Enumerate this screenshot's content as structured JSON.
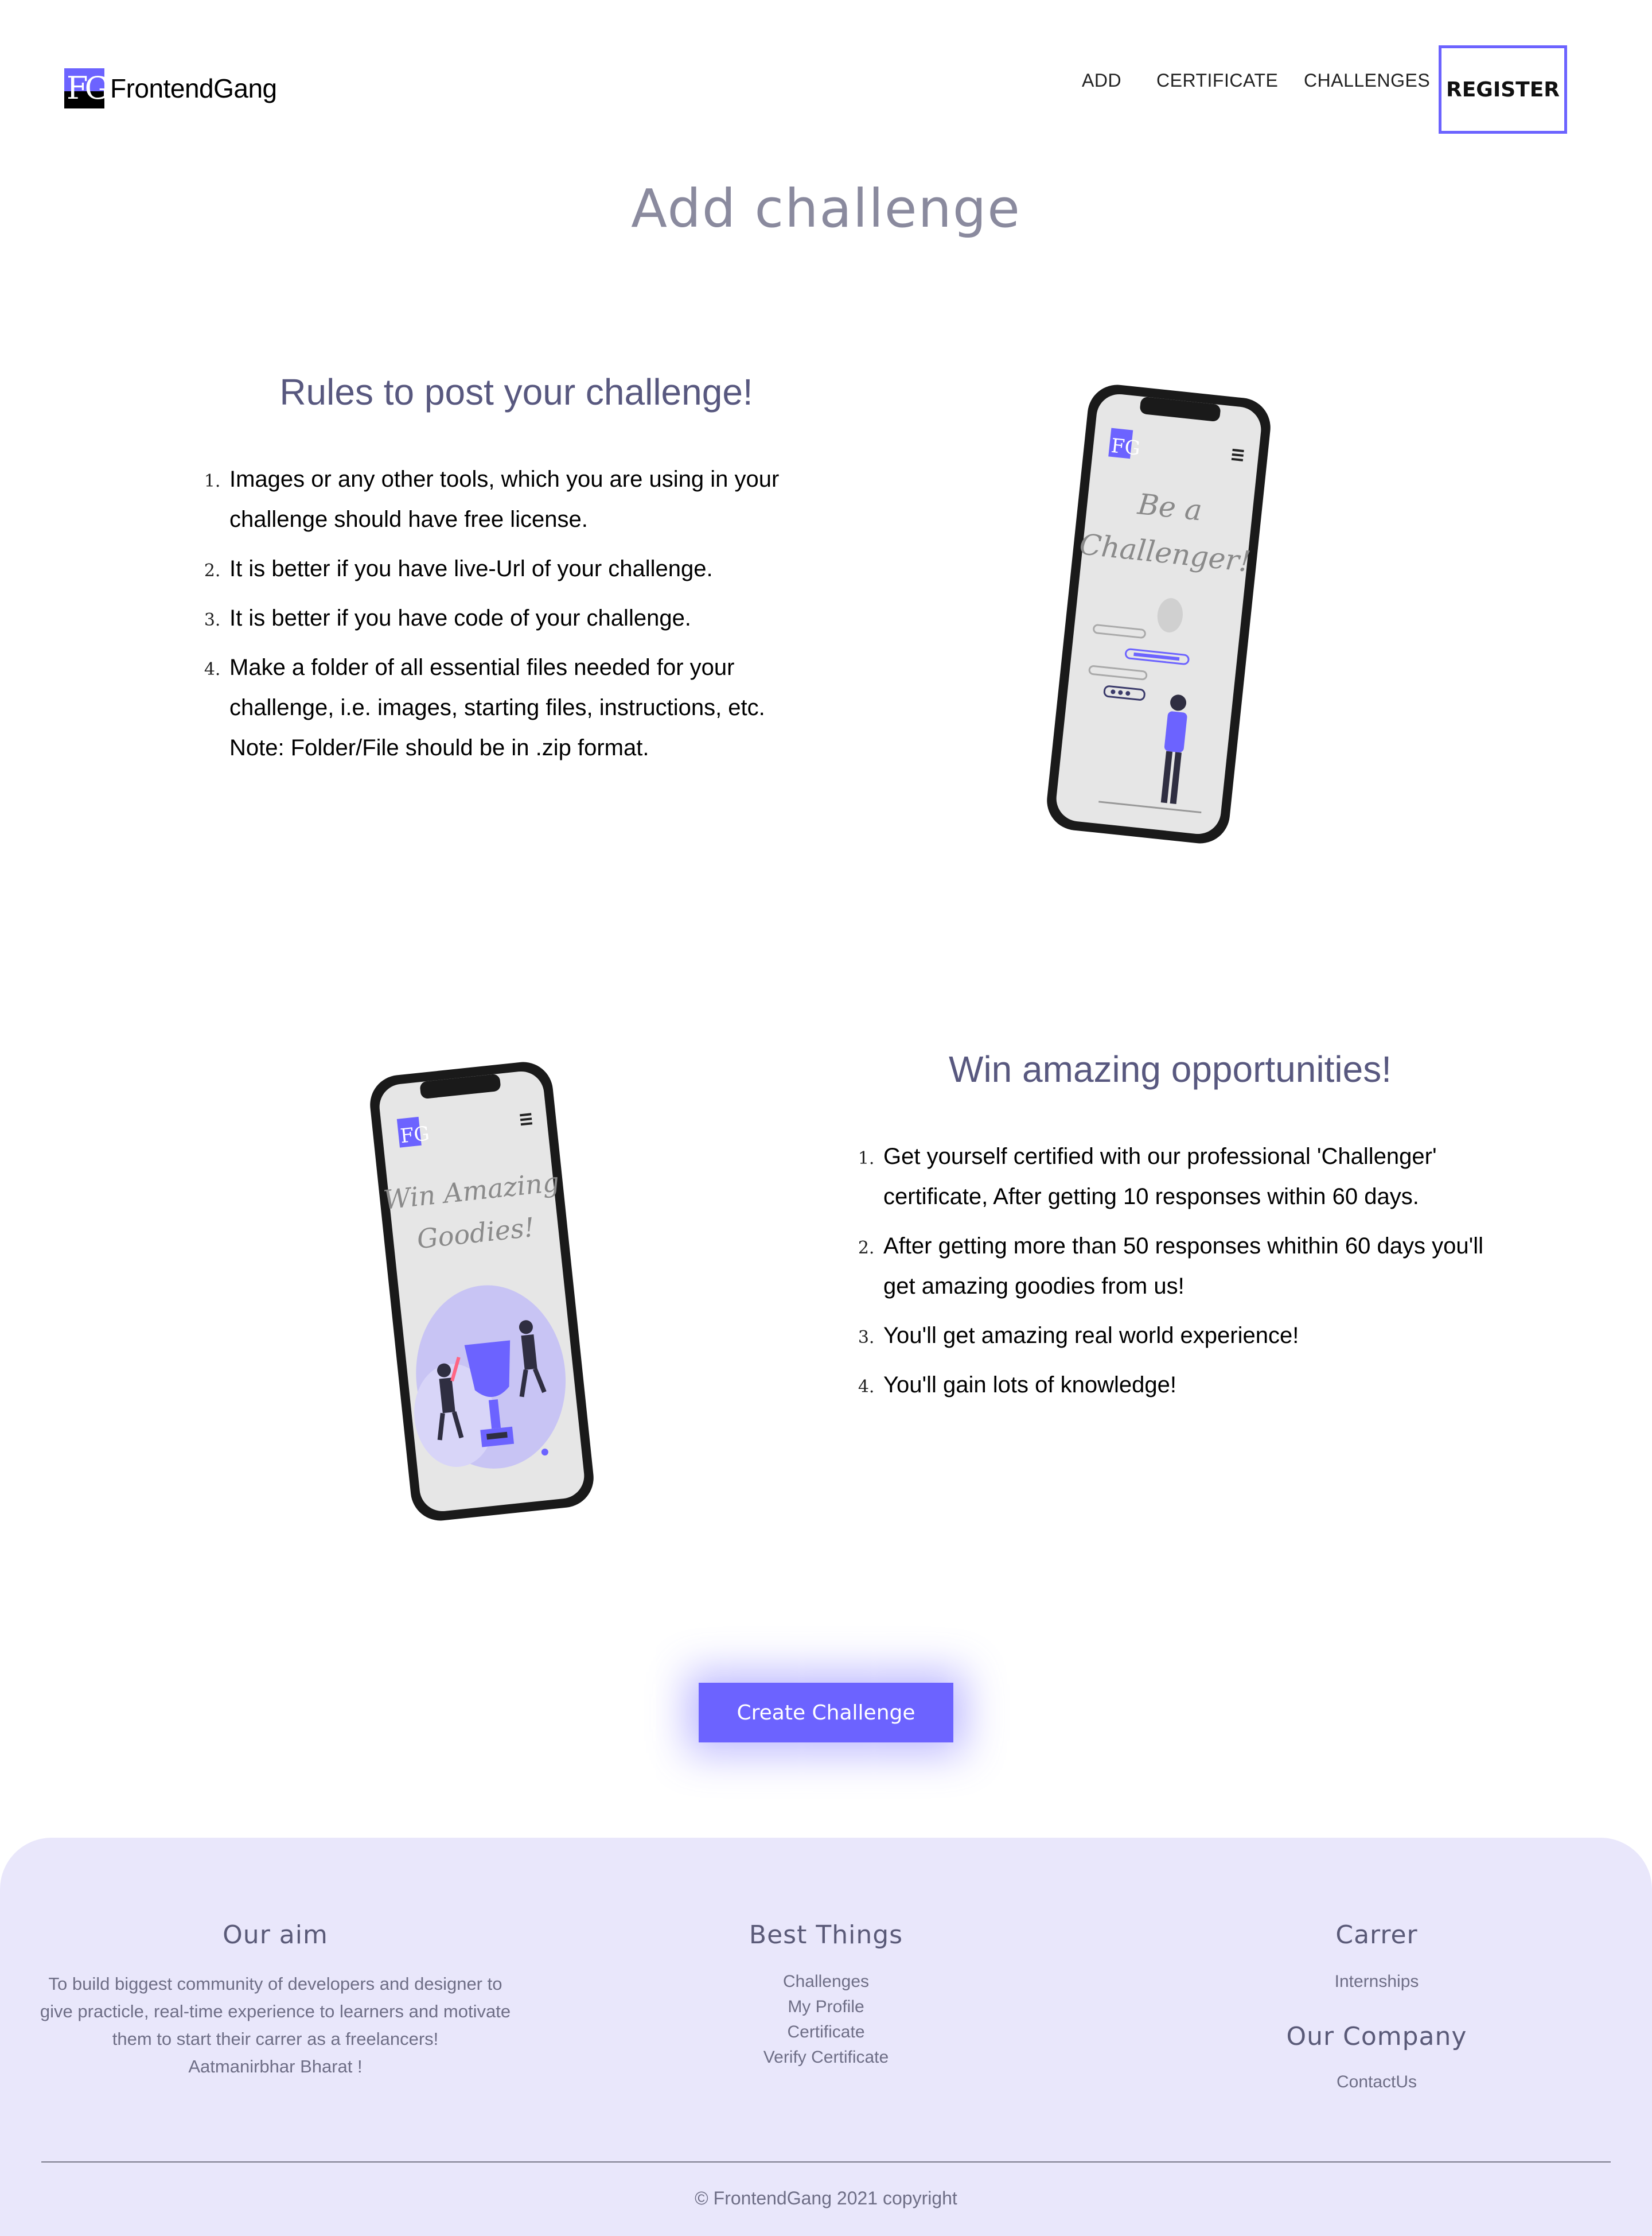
{
  "header": {
    "logo_mark": "FG",
    "logo_text": "FrontendGang",
    "nav": [
      "ADD",
      "CERTIFICATE",
      "CHALLENGES"
    ],
    "register_label": "REGISTER"
  },
  "page_title": "Add challenge",
  "rules_section": {
    "heading": "Rules to post your challenge!",
    "items": [
      "Images or any other tools, which you are using in your challenge should have free license.",
      "It is better if you have live-Url of your challenge.",
      "It is better if you have code of your challenge.",
      "Make a folder of all essential files needed for your challenge, i.e. images, starting files, instructions, etc."
    ],
    "note": "Note: Folder/File should be in .zip format.",
    "phone_screen_text": [
      "Be a",
      "Challenger!"
    ]
  },
  "opportunities_section": {
    "heading": "Win amazing opportunities!",
    "items": [
      "Get yourself certified with our professional 'Challenger' certificate, After getting 10 responses within 60 days.",
      "After getting more than 50 responses whithin 60 days you'll get amazing goodies from us!",
      "You'll get amazing real world experience!",
      "You'll gain lots of knowledge!"
    ],
    "phone_screen_text": [
      "Win Amazing",
      "Goodies!"
    ]
  },
  "cta": {
    "label": "Create Challenge"
  },
  "footer": {
    "aim": {
      "heading": "Our aim",
      "text": "To build biggest community of developers and designer to give practicle, real-time experience to learners and motivate them to start their carrer as a freelancers!",
      "tagline": "Aatmanirbhar Bharat !"
    },
    "best_things": {
      "heading": "Best Things",
      "links": [
        "Challenges",
        "My Profile",
        "Certificate",
        "Verify Certificate"
      ]
    },
    "carrer": {
      "heading": "Carrer",
      "links": [
        "Internships"
      ]
    },
    "company": {
      "heading": "Our Company",
      "links": [
        "ContactUs"
      ]
    },
    "copyright": "© FrontendGang 2021 copyright"
  },
  "colors": {
    "accent": "#6c63ff",
    "footer_bg": "#e9e7fb",
    "heading": "#58587f",
    "title": "#8a8a9e"
  }
}
